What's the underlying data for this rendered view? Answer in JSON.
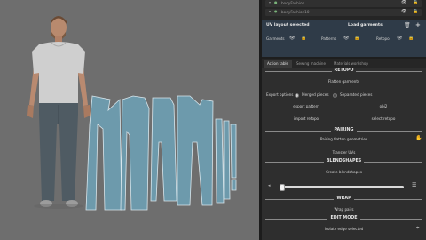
{
  "outliner": {
    "row1_label": "bodyFashion",
    "row2_label": "bodyFashion10"
  },
  "layout": {
    "left_title": "UV layout selected",
    "right_title": "Load garments",
    "toggles": [
      {
        "label": "Garments"
      },
      {
        "label": "Patterns"
      },
      {
        "label": "Retopo"
      }
    ]
  },
  "tabs": [
    "Action table",
    "Sewing machine",
    "Materials workshop"
  ],
  "active_tab": 0,
  "sections": {
    "retopo": "RETOPO",
    "pairing": "PAIRING",
    "blendshapes": "BLENDSHAPES",
    "wrap": "WRAP",
    "edit_mode": "EDIT MODE"
  },
  "retopo": {
    "flatten_label": "Flatten garments",
    "export_options_label": "Export options",
    "option_merged": "Merged pieces",
    "option_separated": "Separated pieces",
    "selected_option": "Merged pieces",
    "export_pattern": "export pattern",
    "obj2": "obj2",
    "import_retopo": "import retopo",
    "select_retopo": "select retopo"
  },
  "pairing": {
    "pair_label": "Pairing flatten geometries",
    "transfer_label": "Transfer UVs"
  },
  "blendshapes": {
    "create_label": "Create blendshapes",
    "slider_value": 0
  },
  "wrap": {
    "wrap_label": "Wrap pairs"
  },
  "edit_mode": {
    "label": "Isolate edge selected"
  },
  "colors": {
    "viewport_bg": "#6e6e6e",
    "fabric": "#6d9aac",
    "panel_bg": "#2e2e2e",
    "selected_block": "#2f3b48"
  }
}
